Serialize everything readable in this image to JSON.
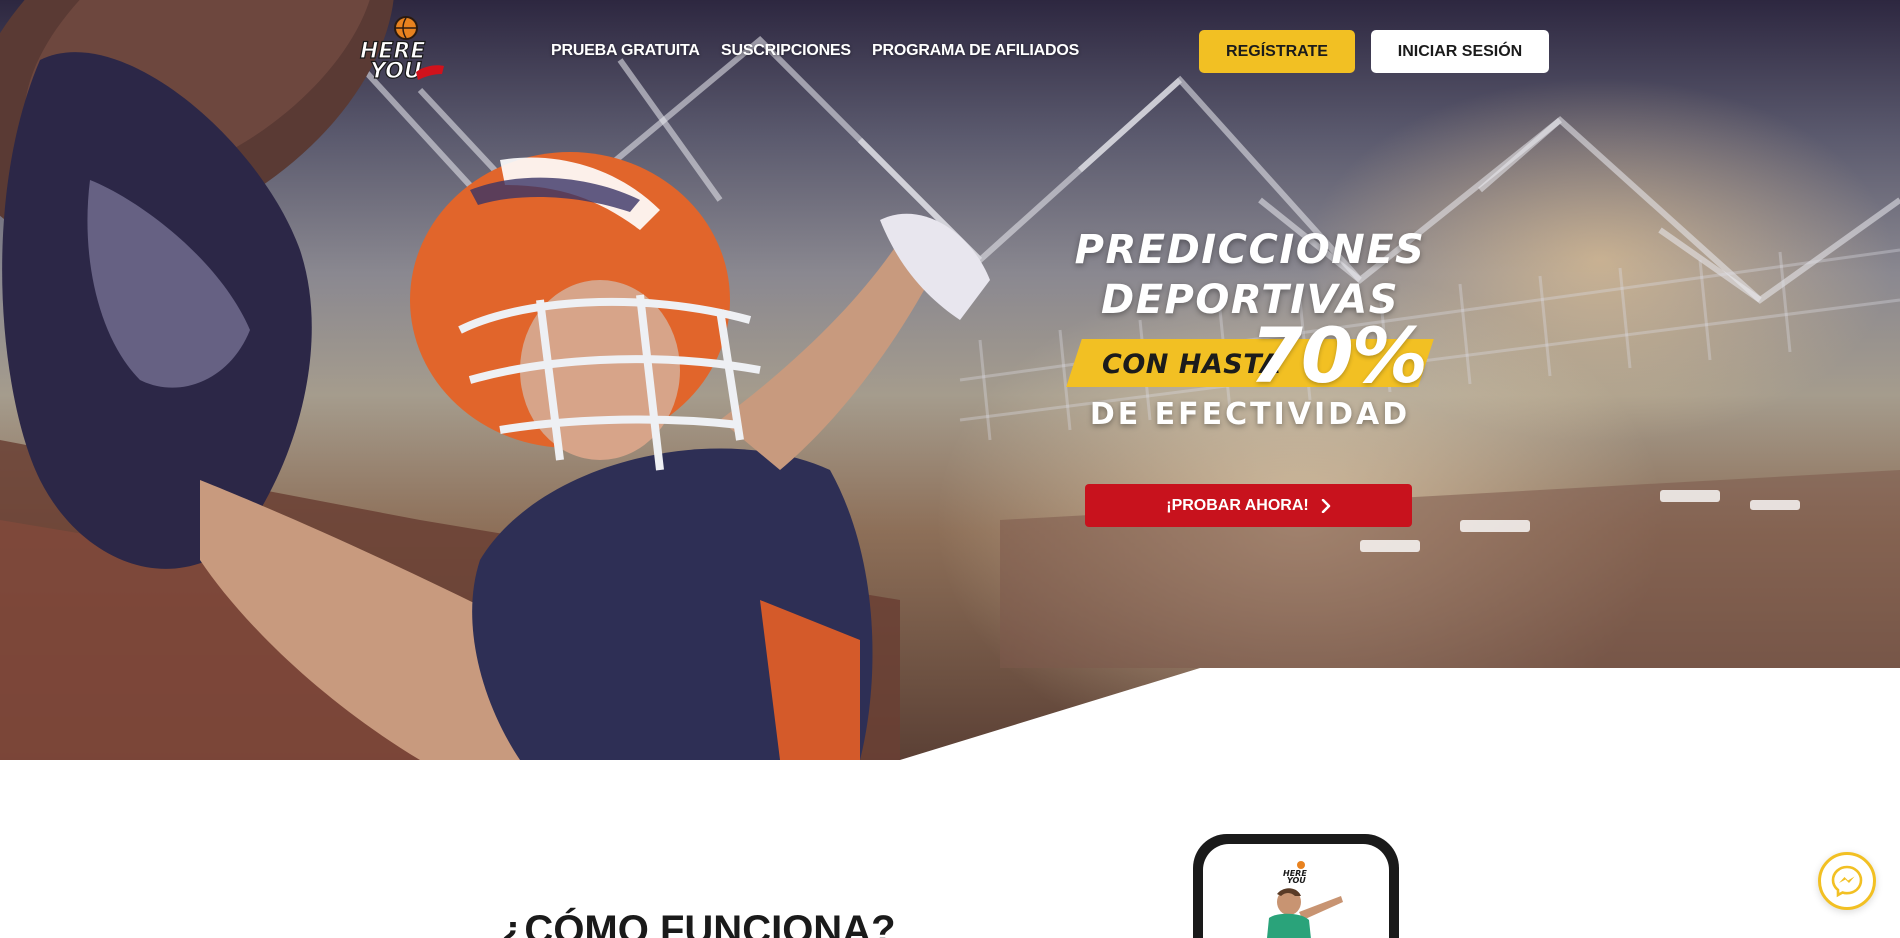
{
  "brand": {
    "logo_text": "HERE YOU"
  },
  "nav": {
    "links": [
      "PRUEBA GRATUITA",
      "SUSCRIPCIONES",
      "PROGRAMA DE AFILIADOS"
    ],
    "register_label": "REGÍSTRATE",
    "login_label": "INICIAR SESIÓN"
  },
  "hero": {
    "line1": "PREDICCIONES",
    "line2": "DEPORTIVAS",
    "stripe_text": "CON HASTA",
    "percent": "70%",
    "line3": "DE EFECTIVIDAD",
    "cta_label": "¡PROBAR AHORA!",
    "cta_icon": "chevron-right-icon"
  },
  "how": {
    "title": "¿CÓMO FUNCIONA?"
  },
  "chat": {
    "icon": "messenger-icon"
  },
  "colors": {
    "accent_yellow": "#f2c023",
    "cta_red": "#c8121d",
    "text_dark": "#1a1a1a"
  }
}
